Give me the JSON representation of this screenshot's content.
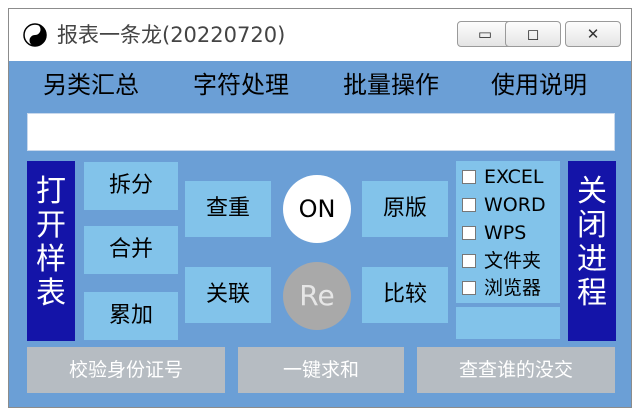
{
  "window": {
    "title": "报表一条龙(20220720)",
    "icon": "yin-yang-icon",
    "controls": {
      "minimize": "minimize-icon",
      "maximize": "maximize-icon",
      "close": "close-icon"
    }
  },
  "menu": [
    "另类汇总",
    "字符处理",
    "批量操作",
    "使用说明"
  ],
  "text_field": {
    "value": ""
  },
  "open_sample": [
    "打",
    "开",
    "样",
    "表"
  ],
  "close_process": [
    "关",
    "闭",
    "进",
    "程"
  ],
  "left_buttons": {
    "split": "拆分",
    "merge": "合并",
    "accumulate": "累加"
  },
  "mid_buttons": {
    "dedupe": "查重",
    "link": "关联"
  },
  "circles": {
    "on": "ON",
    "re": "Re"
  },
  "right_buttons": {
    "original": "原版",
    "compare": "比较"
  },
  "checkboxes": [
    "EXCEL",
    "WORD",
    "WPS",
    "文件夹",
    "浏览器"
  ],
  "bottom_buttons": {
    "id_check": "校验身份证号",
    "sum": "一键求和",
    "who_missing": "查查谁的没交"
  },
  "colors": {
    "panel": "#6b9fd6",
    "button": "#82c3ea",
    "side_button": "#1414a8",
    "gray_button": "#b6bcc2"
  }
}
